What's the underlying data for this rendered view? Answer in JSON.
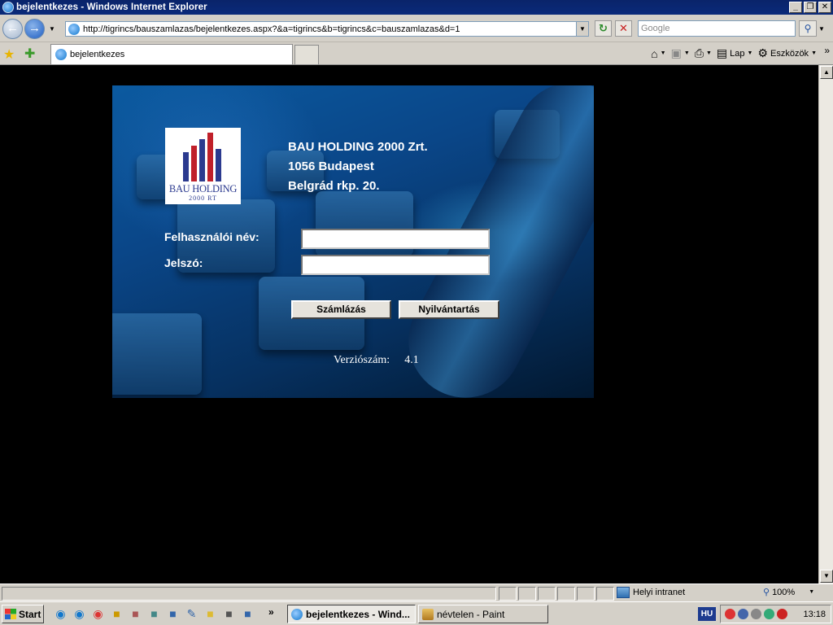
{
  "window": {
    "title": "bejelentkezes - Windows Internet Explorer",
    "controls": {
      "minimize": "_",
      "restore": "❐",
      "close": "✕"
    }
  },
  "addressbar": {
    "url": "http://tigrincs/bauszamlazas/bejelentkezes.aspx?&a=tigrincs&b=tigrincs&c=bauszamlazas&d=1",
    "search_placeholder": "Google"
  },
  "tabs": {
    "active_label": "bejelentkezes"
  },
  "commandbar": {
    "page_label": "Lap",
    "tools_label": "Eszközök"
  },
  "login": {
    "logo_text": "BAU HOLDING",
    "logo_sub": "2000 RT",
    "company_lines": [
      "BAU HOLDING 2000 Zrt.",
      "1056 Budapest",
      "Belgrád rkp. 20."
    ],
    "username_label": "Felhasználói név:",
    "username_value": "",
    "password_label": "Jelszó:",
    "password_value": "",
    "billing_button": "Számlázás",
    "registry_button": "Nyilvántartás",
    "version_label": "Verziószám:",
    "version_value": "4.1",
    "logo_colors": {
      "primary": "#2b3a8f",
      "accent": "#c0202a"
    }
  },
  "statusbar": {
    "zone": "Helyi intranet",
    "zoom": "100%"
  },
  "taskbar": {
    "start_label": "Start",
    "tasks": [
      "bejelentkezes - Wind...",
      "névtelen - Paint"
    ],
    "language": "HU",
    "clock": "13:18"
  }
}
